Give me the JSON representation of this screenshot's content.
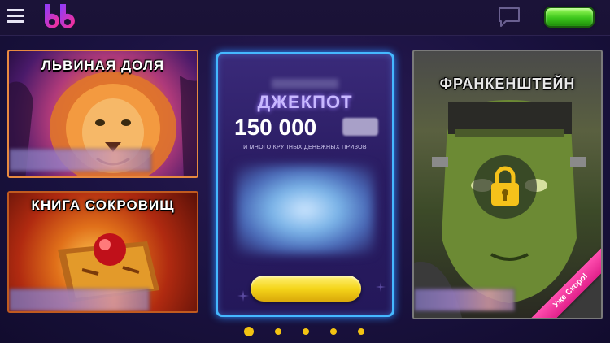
{
  "header": {
    "menu_icon": "hamburger-menu-icon",
    "logo_icon": "bb-logo-icon",
    "chat_icon": "chat-bubble-icon",
    "colors": {
      "accent_green": "#3cc61c",
      "logo_pink": "#ff3aa0"
    }
  },
  "cards": {
    "lion": {
      "title": "ЛЬВИНАЯ ДОЛЯ"
    },
    "book": {
      "title": "КНИГА СОКРОВИЩ"
    },
    "jackpot": {
      "label": "ДЖЕКПОТ",
      "amount": "150 000",
      "subtitle": "И МНОГО КРУПНЫХ ДЕНЕЖНЫХ ПРИЗОВ",
      "border_color": "#45b8ff"
    },
    "frankenstein": {
      "title": "ФРАНКЕНШТЕЙН",
      "lock_icon": "padlock-icon",
      "ribbon": "Уже Скоро!"
    }
  },
  "pagination": {
    "total": 5,
    "active": 1,
    "color": "#f3c312"
  }
}
